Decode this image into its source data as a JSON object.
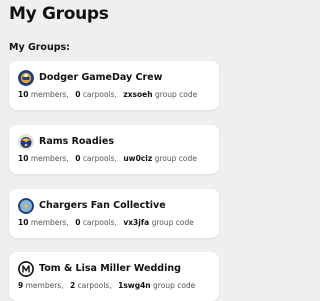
{
  "header": {
    "title": "My Groups"
  },
  "section": {
    "title": "My Groups:"
  },
  "labels": {
    "members": "members,",
    "carpools": "carpools,",
    "group_code": "group code"
  },
  "groups": [
    {
      "name": "Dodger GameDay Crew",
      "members": "10",
      "carpools": "0",
      "code": "zxsoeh",
      "icon": "dodgers-logo-icon"
    },
    {
      "name": "Rams Roadies",
      "members": "10",
      "carpools": "0",
      "code": "uw0ciz",
      "icon": "rams-logo-icon"
    },
    {
      "name": "Chargers Fan Collective",
      "members": "10",
      "carpools": "0",
      "code": "vx3jfa",
      "icon": "chargers-logo-icon"
    },
    {
      "name": "Tom & Lisa Miller Wedding",
      "members": "9",
      "carpools": "2",
      "code": "1swg4n",
      "icon": "metro-logo-icon"
    }
  ]
}
